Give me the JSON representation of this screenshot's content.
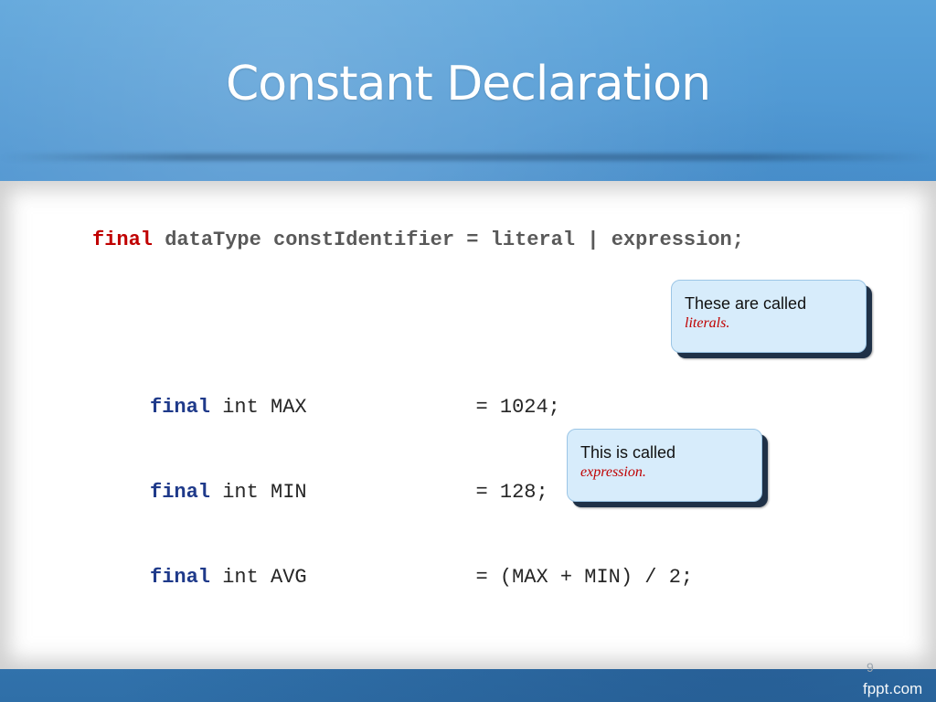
{
  "slide": {
    "title": "Constant Declaration",
    "syntax": {
      "keyword": "final",
      "rest": " dataType constIdentifier = literal | expression;"
    },
    "code_lines": [
      {
        "keyword": "final",
        "rest": " int MAX              = 1024;"
      },
      {
        "keyword": "final",
        "rest": " int MIN              = 128;"
      },
      {
        "keyword": "final",
        "rest": " int AVG              = (MAX + MIN) / 2;"
      }
    ],
    "callouts": [
      {
        "main": "These are called",
        "emphasis": "literals."
      },
      {
        "main": "This is called",
        "emphasis": "expression."
      }
    ],
    "page_number": "9",
    "watermark": "fppt.com"
  },
  "colors": {
    "background": "#3f86c4",
    "keyword_red": "#c00000",
    "keyword_blue": "#1f3a8a",
    "callout_fill": "#d7ecfb"
  }
}
